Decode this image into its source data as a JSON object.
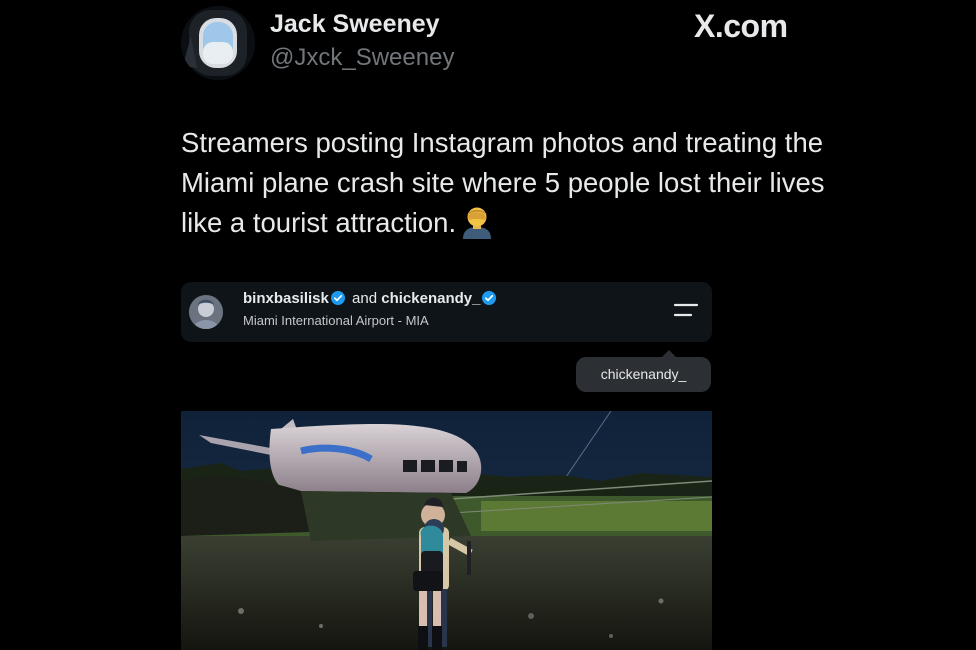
{
  "tweet": {
    "author_name": "Jack Sweeney",
    "author_handle": "@Jxck_Sweeney",
    "brand": "X.com",
    "text": "Streamers posting Instagram photos and treating the Miami plane crash site where 5 people lost their lives like a tourist attraction.",
    "emoji": "face-palm-emoji"
  },
  "instagram_post": {
    "user1": "binxbasilisk",
    "connector": "and",
    "user2": "chickenandy_",
    "location": "Miami International Airport - MIA",
    "tag": "chickenandy_",
    "photo": "crashed-plane-photo"
  },
  "colors": {
    "background": "#000000",
    "text": "#e7e9ea",
    "secondary_text": "#71767b",
    "verified": "#1d9bf0",
    "ig_header_bg": "#0f1419",
    "tag_bg": "#2c2f33"
  }
}
